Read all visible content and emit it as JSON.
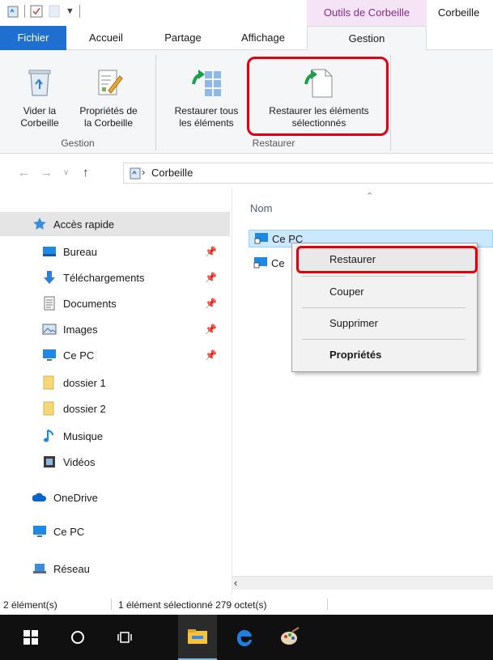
{
  "window": {
    "title": "Corbeille",
    "context_tab_header": "Outils de Corbeille"
  },
  "ribbon": {
    "tabs": [
      {
        "label": "Fichier"
      },
      {
        "label": "Accueil"
      },
      {
        "label": "Partage"
      },
      {
        "label": "Affichage"
      },
      {
        "label": "Gestion"
      }
    ],
    "buttons": {
      "vider": {
        "line1": "Vider la",
        "line2": "Corbeille",
        "icon": "recycle-bin-icon"
      },
      "proprietes": {
        "line1": "Propriétés de",
        "line2": "la Corbeille",
        "icon": "properties-icon"
      },
      "restaurer_tous": {
        "line1": "Restaurer tous",
        "line2": "les éléments",
        "icon": "restore-all-icon"
      },
      "restaurer_selection": {
        "line1": "Restaurer les éléments",
        "line2": "sélectionnés",
        "icon": "restore-selected-icon"
      }
    },
    "groups": {
      "gestion": "Gestion",
      "restaurer": "Restaurer"
    }
  },
  "address": {
    "path": "Corbeille"
  },
  "sidebar": {
    "items": [
      {
        "label": "Accès rapide",
        "icon": "star-icon",
        "pinned": false
      },
      {
        "label": "Bureau",
        "icon": "desktop-icon",
        "pinned": true
      },
      {
        "label": "Téléchargements",
        "icon": "download-icon",
        "pinned": true
      },
      {
        "label": "Documents",
        "icon": "document-icon",
        "pinned": true
      },
      {
        "label": "Images",
        "icon": "image-icon",
        "pinned": true
      },
      {
        "label": "Ce PC",
        "icon": "computer-icon",
        "pinned": true
      },
      {
        "label": "dossier 1",
        "icon": "folder-icon",
        "pinned": false
      },
      {
        "label": "dossier 2",
        "icon": "folder-icon",
        "pinned": false
      },
      {
        "label": "Musique",
        "icon": "music-icon",
        "pinned": false
      },
      {
        "label": "Vidéos",
        "icon": "video-icon",
        "pinned": false
      },
      {
        "label": "OneDrive",
        "icon": "cloud-icon",
        "pinned": false
      },
      {
        "label": "Ce PC",
        "icon": "computer-icon",
        "pinned": false
      },
      {
        "label": "Réseau",
        "icon": "network-icon",
        "pinned": false
      }
    ]
  },
  "filelist": {
    "column_name": "Nom",
    "rows": [
      {
        "label": "Ce PC",
        "selected": true
      },
      {
        "label": "Ce",
        "selected": false
      }
    ]
  },
  "context_menu": {
    "items": [
      "Restaurer",
      "Couper",
      "Supprimer",
      "Propriétés"
    ]
  },
  "status": {
    "count": "2 élément(s)",
    "selection": "1 élément sélectionné 279 octet(s)"
  },
  "colors": {
    "accent": "#1e6fd0",
    "context_tab": "#f5e4f6",
    "highlight": "#e0000f",
    "selection": "#cce8ff"
  }
}
